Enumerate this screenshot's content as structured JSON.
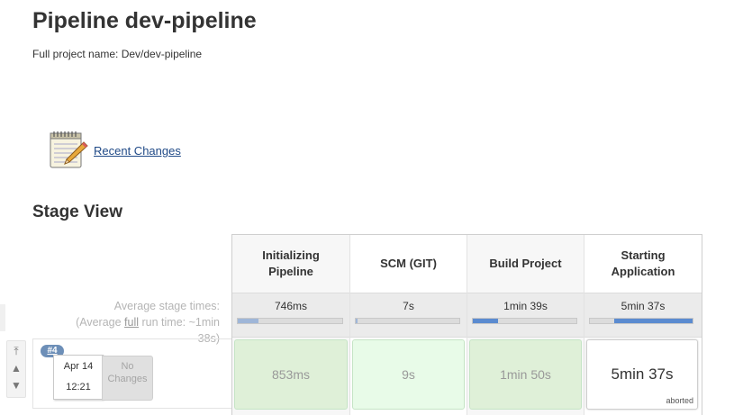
{
  "page": {
    "title": "Pipeline dev-pipeline",
    "full_name": "Full project name: Dev/dev-pipeline"
  },
  "links": {
    "recent_changes": "Recent Changes"
  },
  "stage_view": {
    "title": "Stage View",
    "avg_label_line1": "Average stage times:",
    "avg_label_prefix": "(Average ",
    "avg_label_full": "full",
    "avg_label_suffix": " run time: ~1min 38s)",
    "stages": [
      {
        "name": "Initializing Pipeline",
        "avg": "746ms",
        "progress": 0.2
      },
      {
        "name": "SCM (GIT)",
        "avg": "7s",
        "progress": 0.02
      },
      {
        "name": "Build Project",
        "avg": "1min 39s",
        "progress": 0.24
      },
      {
        "name": "Starting Application",
        "avg": "5min 37s",
        "progress": 0.76
      }
    ],
    "build": {
      "number": "#4",
      "date": "Apr 14",
      "time": "12:21",
      "changes": "No Changes",
      "cells": [
        {
          "value": "853ms",
          "status": ""
        },
        {
          "value": "9s",
          "status": ""
        },
        {
          "value": "1min 50s",
          "status": ""
        },
        {
          "value": "5min 37s",
          "status": "aborted"
        }
      ]
    }
  },
  "colors": {
    "success_cell": "#dff0d8",
    "success_cell_light": "#e8fbe8",
    "progress_fill": "#5b8bd0",
    "link": "#204a87"
  }
}
